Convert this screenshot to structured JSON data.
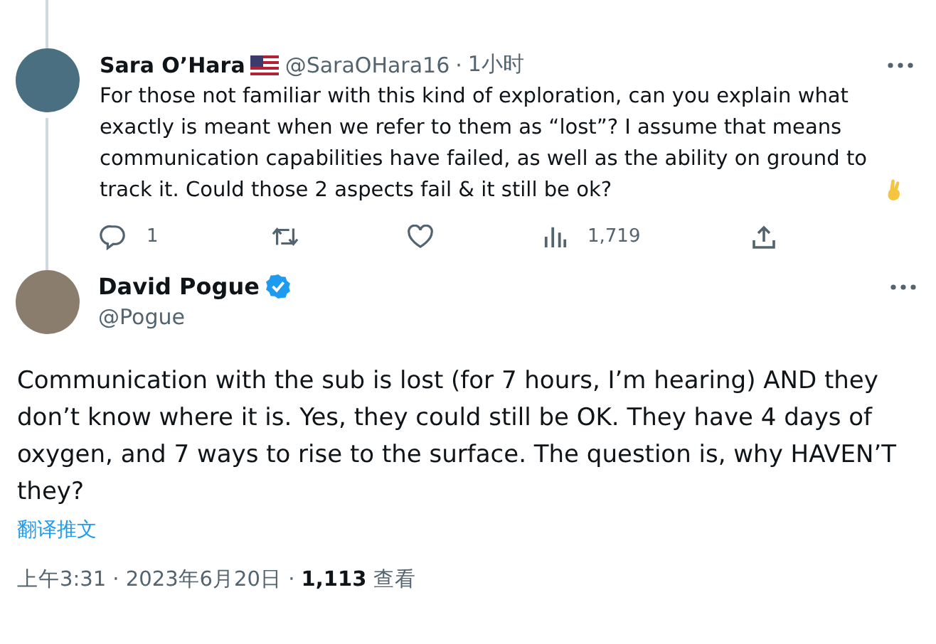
{
  "reply": {
    "name": "Sara O’Hara",
    "handle": "@SaraOHara16",
    "separator": "·",
    "time": "1小时",
    "text": "For those not familiar with this kind of exploration, can you explain what exactly is meant when we refer to them as “lost”? I assume that means communication capabilities have failed, as well as the ability on ground to track it. Could those 2 aspects fail & it still be ok?",
    "actions": [
      {
        "kind": "reply",
        "count": "1"
      },
      {
        "kind": "retweet"
      },
      {
        "kind": "like"
      },
      {
        "kind": "views",
        "count": "1,719"
      },
      {
        "kind": "share"
      }
    ]
  },
  "tweet": {
    "name": "David Pogue",
    "verified": true,
    "handle": "@Pogue",
    "text": "Communication with the sub is lost (for 7 hours, I’m hearing) AND they don’t know where it is. Yes, they could still be OK. They have 4 days of oxygen, and 7 ways to rise to the surface. The question is, why HAVEN’T they?",
    "translate": "翻译推文",
    "timestamp": "上午3:31 · 2023年6月20日 · **1,113** 查看"
  }
}
